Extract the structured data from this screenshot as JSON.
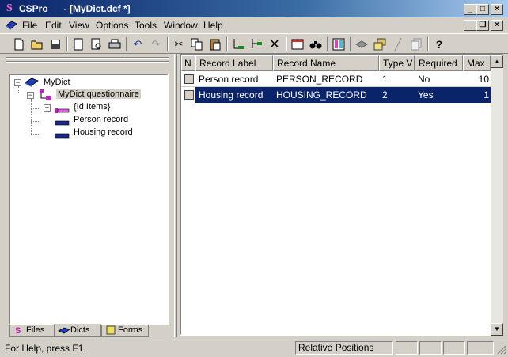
{
  "window": {
    "logo": "S",
    "title": "CSPro      - [MyDict.dcf *]",
    "buttons": [
      "minimize",
      "maximize",
      "close"
    ]
  },
  "menu": {
    "items": [
      "File",
      "Edit",
      "View",
      "Options",
      "Tools",
      "Window",
      "Help"
    ]
  },
  "toolbar": {
    "icons": [
      "new-icon",
      "open-icon",
      "save-icon",
      "page-icon",
      "print-preview-icon",
      "print-icon",
      "undo-icon",
      "redo-icon",
      "cut-icon",
      "copy-icon",
      "paste-icon",
      "add-item-icon",
      "insert-item-icon",
      "delete-icon",
      "properties-icon",
      "find-icon",
      "color-grid-icon",
      "layers-icon",
      "stack-icon",
      "pencil-icon",
      "pages-icon",
      "help-icon"
    ]
  },
  "tree": {
    "root": "MyDict",
    "questionnaire": "MyDict questionnaire",
    "items": [
      "{Id Items}",
      "Person record",
      "Housing record"
    ]
  },
  "tabs": [
    "Files",
    "Dicts",
    "Forms"
  ],
  "grid": {
    "headers": [
      "N",
      "Record Label",
      "Record Name",
      "Type V",
      "Required",
      "Max"
    ],
    "rows": [
      {
        "label": "Person record",
        "name": "PERSON_RECORD",
        "type": "1",
        "required": "No",
        "max": "10"
      },
      {
        "label": "Housing record",
        "name": "HOUSING_RECORD",
        "type": "2",
        "required": "Yes",
        "max": "1"
      }
    ],
    "selected_row": 1
  },
  "status": {
    "help": "For Help, press F1",
    "mode": "Relative Positions"
  },
  "colors": {
    "selection": "#0a246a",
    "face": "#d4d0c8"
  }
}
